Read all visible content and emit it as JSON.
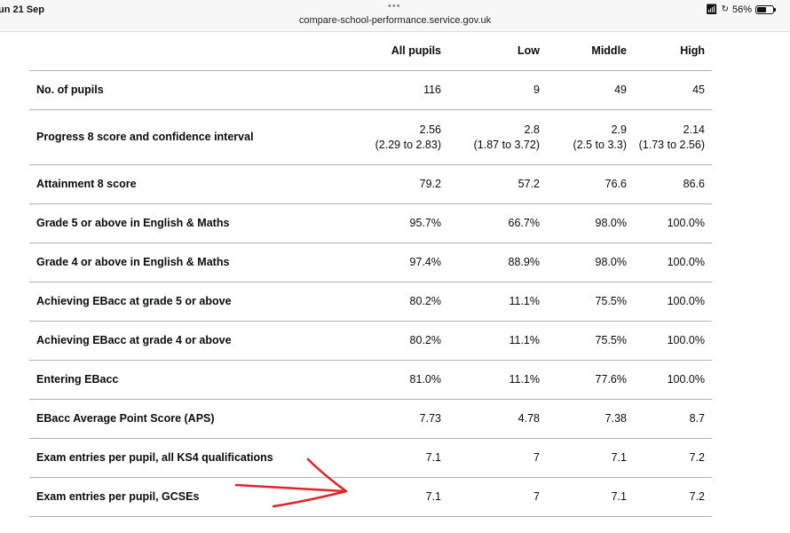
{
  "status_bar": {
    "date": "un 21 Sep",
    "dots": "•••",
    "url": "compare-school-performance.service.gov.uk",
    "wifi_icon": "wifi-icon",
    "battery_percent": "56%"
  },
  "table": {
    "headers": [
      "",
      "All pupils",
      "Low",
      "Middle",
      "High"
    ],
    "rows": [
      {
        "label": "No. of pupils",
        "all": "116",
        "low": "9",
        "middle": "49",
        "high": "45"
      },
      {
        "label": "Progress 8 score and confidence interval",
        "all": "2.56",
        "all_ci": "(2.29 to 2.83)",
        "low": "2.8",
        "low_ci": "(1.87 to 3.72)",
        "middle": "2.9",
        "middle_ci": "(2.5 to 3.3)",
        "high": "2.14",
        "high_ci": "(1.73 to 2.56)"
      },
      {
        "label": "Attainment 8 score",
        "all": "79.2",
        "low": "57.2",
        "middle": "76.6",
        "high": "86.6"
      },
      {
        "label": "Grade 5 or above in English & Maths",
        "all": "95.7%",
        "low": "66.7%",
        "middle": "98.0%",
        "high": "100.0%"
      },
      {
        "label": "Grade 4 or above in English & Maths",
        "all": "97.4%",
        "low": "88.9%",
        "middle": "98.0%",
        "high": "100.0%"
      },
      {
        "label": "Achieving EBacc at grade 5 or above",
        "all": "80.2%",
        "low": "11.1%",
        "middle": "75.5%",
        "high": "100.0%"
      },
      {
        "label": "Achieving EBacc at grade 4 or above",
        "all": "80.2%",
        "low": "11.1%",
        "middle": "75.5%",
        "high": "100.0%"
      },
      {
        "label": "Entering EBacc",
        "all": "81.0%",
        "low": "11.1%",
        "middle": "77.6%",
        "high": "100.0%"
      },
      {
        "label": "EBacc Average Point Score (APS)",
        "all": "7.73",
        "low": "4.78",
        "middle": "7.38",
        "high": "8.7"
      },
      {
        "label": "Exam entries per pupil, all KS4 qualifications",
        "all": "7.1",
        "low": "7",
        "middle": "7.1",
        "high": "7.2"
      },
      {
        "label": "Exam entries per pupil, GCSEs",
        "all": "7.1",
        "low": "7",
        "middle": "7.1",
        "high": "7.2"
      }
    ]
  },
  "annotation": {
    "color": "#e0242a"
  }
}
